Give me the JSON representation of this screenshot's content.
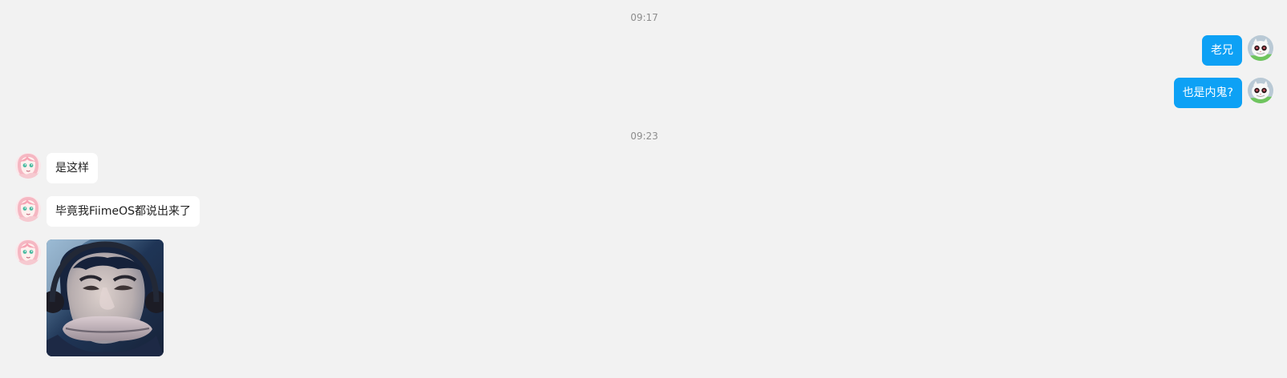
{
  "conversation": {
    "time_1": "09:17",
    "time_2": "09:23",
    "messages": [
      {
        "sender": "me",
        "text": "老兄"
      },
      {
        "sender": "me",
        "text": "也是内鬼?"
      },
      {
        "sender": "contact",
        "text": "是这样"
      },
      {
        "sender": "contact",
        "text": "毕竟我FiimeOS都说出来了"
      },
      {
        "sender": "contact",
        "image": "stretched-face-image"
      }
    ]
  },
  "colors": {
    "background": "#f2f2f2",
    "outgoing_bubble": "#0da1f5",
    "incoming_bubble": "#ffffff",
    "timestamp": "#8d8d8d"
  },
  "icons": {
    "self_avatar": "cat-avatar",
    "contact_avatar": "pink-anime-avatar"
  }
}
